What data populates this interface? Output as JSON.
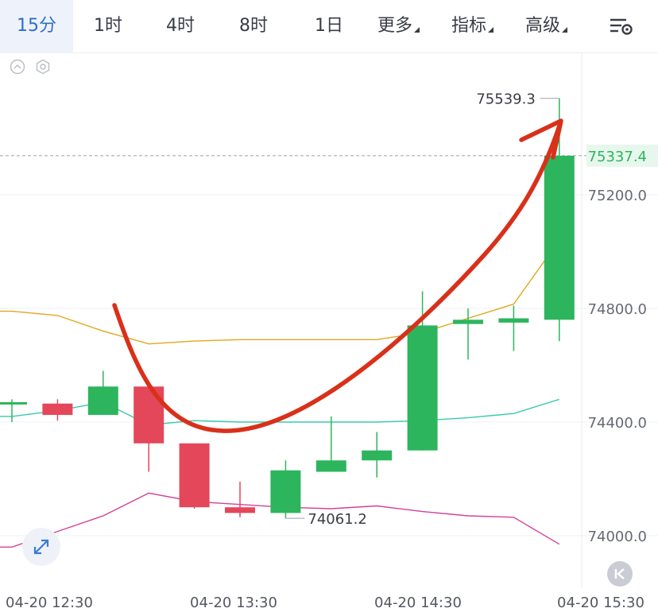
{
  "toolbar": {
    "tabs": [
      {
        "label": "15分",
        "active": true
      },
      {
        "label": "1时"
      },
      {
        "label": "4时"
      },
      {
        "label": "8时"
      },
      {
        "label": "1日"
      },
      {
        "label": "更多",
        "dropdown": true
      },
      {
        "label": "指标",
        "dropdown": true
      },
      {
        "label": "高级",
        "dropdown": true
      }
    ],
    "settings_icon": "chart-settings-icon"
  },
  "chart_data": {
    "type": "candlestick",
    "interval": "15分",
    "x_axis_labels": [
      "04-20 12:30",
      "04-20 13:30",
      "04-20 14:30",
      "04-20 15:30"
    ],
    "price_labels": [
      "75200.0",
      "74800.0",
      "74400.0",
      "74000.0"
    ],
    "last_price": "75337.4",
    "high_label": "75539.3",
    "low_label": "74061.2",
    "colors": {
      "up": "#2db55d",
      "down": "#e4475a",
      "upper_band": "#e0a81c",
      "mid_band": "#3cc8ad",
      "lower_band": "#d4409a",
      "last_price_bg": "#e8f7ee",
      "last_price_text": "#2db55d",
      "arrow": "#d9301a"
    },
    "candles": [
      {
        "open": 74470,
        "high": 74480,
        "low": 74400,
        "close": 74470
      },
      {
        "open": 74465,
        "high": 74480,
        "low": 74405,
        "close": 74425
      },
      {
        "open": 74425,
        "high": 74580,
        "low": 74425,
        "close": 74525
      },
      {
        "open": 74525,
        "high": 74525,
        "low": 74225,
        "close": 74325
      },
      {
        "open": 74325,
        "high": 74325,
        "low": 74095,
        "close": 74100
      },
      {
        "open": 74100,
        "high": 74190,
        "low": 74065,
        "close": 74080
      },
      {
        "open": 74080,
        "high": 74265,
        "low": 74061.2,
        "close": 74230
      },
      {
        "open": 74225,
        "high": 74420,
        "low": 74225,
        "close": 74265
      },
      {
        "open": 74265,
        "high": 74365,
        "low": 74205,
        "close": 74300
      },
      {
        "open": 74300,
        "high": 74860,
        "low": 74300,
        "close": 74740
      },
      {
        "open": 74745,
        "high": 74800,
        "low": 74620,
        "close": 74760
      },
      {
        "open": 74750,
        "high": 74810,
        "low": 74650,
        "close": 74765
      },
      {
        "open": 74760,
        "high": 75539.3,
        "low": 74685,
        "close": 75337.4
      }
    ],
    "upper_band": [
      74790,
      74775,
      74720,
      74675,
      74685,
      74690,
      74690,
      74690,
      74690,
      74715,
      74765,
      74815,
      75040
    ],
    "mid_band": [
      74420,
      74440,
      74470,
      74390,
      74405,
      74400,
      74400,
      74400,
      74400,
      74405,
      74415,
      74430,
      74480
    ],
    "lower_band": [
      73960,
      74015,
      74070,
      74150,
      74120,
      74110,
      74100,
      74095,
      74105,
      74085,
      74070,
      74065,
      73970
    ]
  }
}
